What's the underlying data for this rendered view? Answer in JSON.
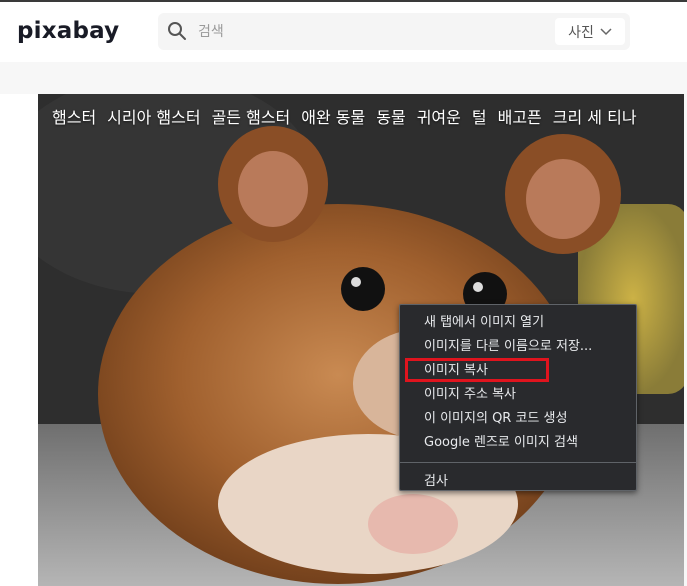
{
  "header": {
    "logo_text": "pixabay",
    "search": {
      "placeholder": "검색",
      "value": ""
    },
    "type_select": {
      "selected": "사진"
    }
  },
  "tags": [
    "햄스터",
    "시리아 햄스터",
    "골든 햄스터",
    "애완 동물",
    "동물",
    "귀여운",
    "털",
    "배고픈",
    "크리 세 티나"
  ],
  "context_menu": {
    "items": [
      "새 탭에서 이미지 열기",
      "이미지를 다른 이름으로 저장...",
      "이미지 복사",
      "이미지 주소 복사",
      "이 이미지의 QR 코드 생성",
      "Google 렌즈로 이미지 검색"
    ],
    "inspect": "검사",
    "highlighted_item": "이미지 복사"
  },
  "colors": {
    "menu_bg": "#292a2d",
    "menu_text": "#e8eaed",
    "highlight": "#e0141e"
  }
}
